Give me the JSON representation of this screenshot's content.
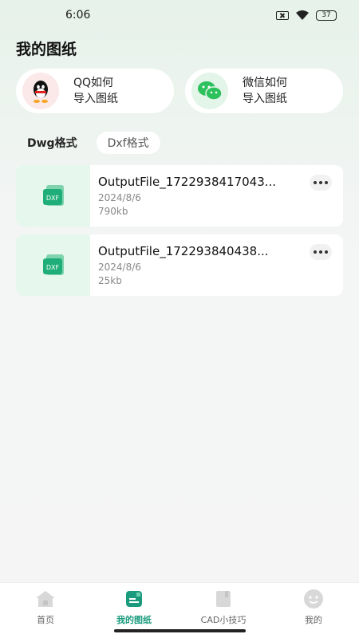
{
  "status": {
    "time": "6:06",
    "battery": "37"
  },
  "page": {
    "title": "我的图纸"
  },
  "guides": [
    {
      "line1": "QQ如何",
      "line2": "导入图纸",
      "icon": "qq-penguin-icon"
    },
    {
      "line1": "微信如何",
      "line2": "导入图纸",
      "icon": "wechat-icon"
    }
  ],
  "tabs": [
    {
      "label": "Dwg格式",
      "active": true
    },
    {
      "label": "Dxf格式",
      "active": false
    }
  ],
  "files": [
    {
      "name": "OutputFile_1722938417043...",
      "date": "2024/8/6",
      "size": "790kb",
      "thumb_label": "DXF"
    },
    {
      "name": "OutputFile_172293840438...",
      "date": "2024/8/6",
      "size": "25kb",
      "thumb_label": "DXF"
    }
  ],
  "nav": [
    {
      "label": "首页",
      "icon": "home-icon",
      "active": false
    },
    {
      "label": "我的图纸",
      "icon": "drawing-icon",
      "active": true
    },
    {
      "label": "CAD小技巧",
      "icon": "book-icon",
      "active": false
    },
    {
      "label": "我的",
      "icon": "profile-icon",
      "active": false
    }
  ],
  "colors": {
    "accent": "#1b9b7e",
    "thumb_bg": "#e6f7ee"
  }
}
